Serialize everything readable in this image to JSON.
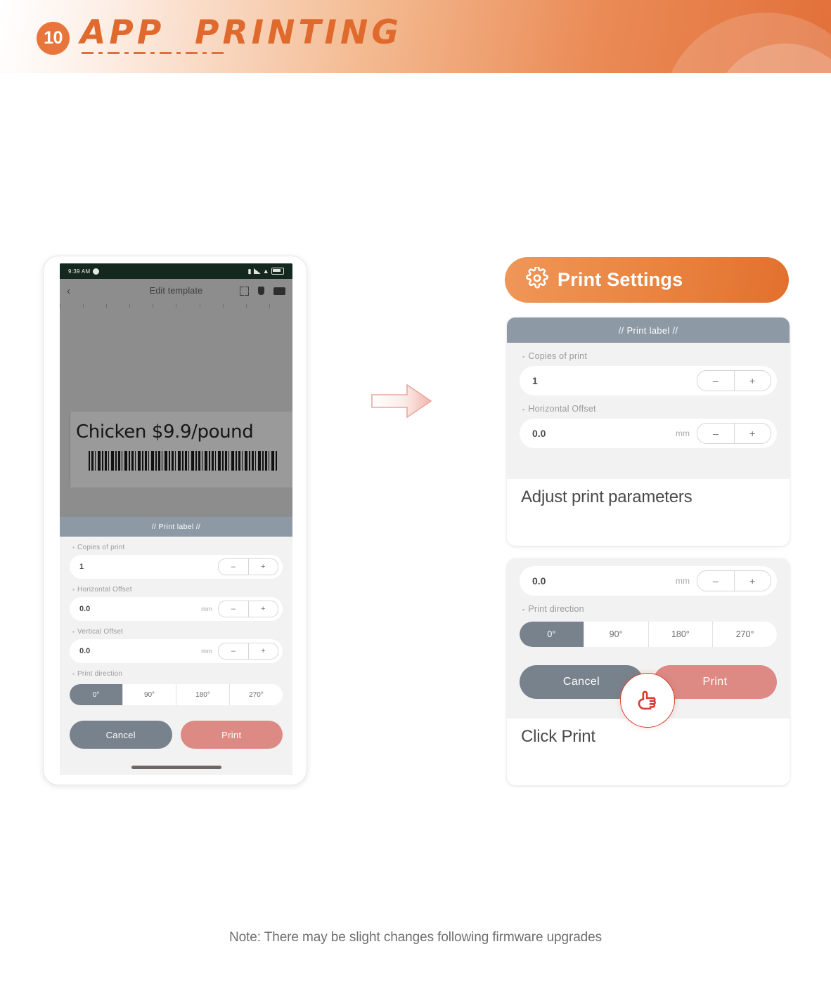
{
  "header": {
    "number": "10",
    "title": "APP  PRINTING"
  },
  "phone": {
    "status_bar": {
      "time": "9:39 AM",
      "icons": [
        "camera-dot-icon",
        "signal-icon",
        "wifi-icon",
        "battery-icon"
      ]
    },
    "app_bar": {
      "back_label": "‹",
      "title": "Edit template",
      "actions": [
        "expand-icon",
        "save-icon",
        "print-icon"
      ]
    },
    "label_preview": {
      "text": "Chicken $9.9/pound",
      "barcode": "barcode-image"
    },
    "sheet": {
      "heading": "// Print label //",
      "fields": [
        {
          "label": "Copies of print",
          "value": "1",
          "unit": "",
          "minus": "–",
          "plus": "+"
        },
        {
          "label": "Horizontal Offset",
          "value": "0.0",
          "unit": "mm",
          "minus": "–",
          "plus": "+"
        },
        {
          "label": "Vertical Offset",
          "value": "0.0",
          "unit": "mm",
          "minus": "–",
          "plus": "+"
        }
      ],
      "direction_label": "Print direction",
      "direction_options": [
        "0°",
        "90°",
        "180°",
        "270°"
      ],
      "direction_selected": "0°",
      "cancel_label": "Cancel",
      "print_label": "Print"
    }
  },
  "arrow": {
    "name": "right-arrow"
  },
  "right": {
    "pill_title": "Print Settings",
    "pill_icon": "gear-icon",
    "card_a": {
      "heading": "// Print label //",
      "fields": [
        {
          "label": "Copies of print",
          "value": "1",
          "unit": "",
          "minus": "–",
          "plus": "+"
        },
        {
          "label": "Horizontal Offset",
          "value": "0.0",
          "unit": "mm",
          "minus": "–",
          "plus": "+"
        }
      ],
      "caption": "Adjust print parameters"
    },
    "card_b": {
      "offset_value": "0.0",
      "offset_unit": "mm",
      "offset_minus": "–",
      "offset_plus": "+",
      "direction_label": "Print direction",
      "direction_options": [
        "0°",
        "90°",
        "180°",
        "270°"
      ],
      "direction_selected": "0°",
      "cancel_label": "Cancel",
      "print_label": "Print",
      "caption": "Click Print",
      "pointer_icon": "pointing-hand-icon"
    }
  },
  "note": "Note: There may be slight changes following firmware upgrades",
  "colors": {
    "brand_orange": "#e2702f",
    "brand_orange_light": "#ef9759",
    "slate": "#78828c",
    "slate_head": "#8d99a5",
    "print_salmon": "#dd8a84",
    "pointer_red": "#d83c32"
  }
}
